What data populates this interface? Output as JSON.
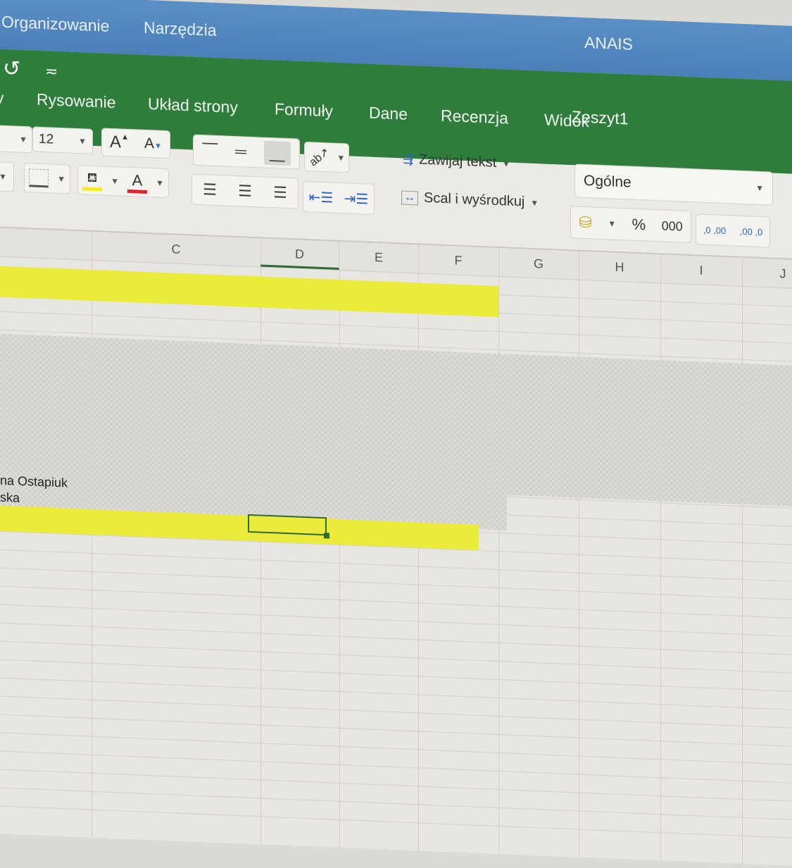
{
  "menubar": {
    "items": [
      "Organizowanie",
      "Narzędzia"
    ],
    "user": "ANAIS"
  },
  "titlebar": {
    "undo_icon": "undo-icon",
    "qat_more_icon": "customize-quick-access-icon",
    "document_title": "Zeszyt1",
    "tabs": [
      "Rysowanie",
      "Układ strony",
      "Formuły",
      "Dane",
      "Recenzja",
      "Widok"
    ]
  },
  "ribbon": {
    "font_size": "12",
    "grow_font": "A",
    "shrink_font": "A",
    "font_color_letter": "A",
    "wrap_text": "Zawijaj tekst",
    "merge_center": "Scal i wyśrodkuj",
    "number_format": "Ogólne",
    "percent": "%",
    "thousands": "000",
    "increase_decimal": ",0 ,00",
    "decrease_decimal": ",00 ,0",
    "colors": {
      "highlight": "#f2ea2a",
      "font_color": "#e0262b",
      "accent_green": "#2f7d3b"
    }
  },
  "sheet": {
    "columns": [
      "C",
      "D",
      "E",
      "F",
      "G",
      "H",
      "I",
      "J"
    ],
    "cells": {
      "row_a": "na Ostapiuk",
      "row_b": "ska"
    },
    "highlight_color": "#eaeb3a"
  }
}
